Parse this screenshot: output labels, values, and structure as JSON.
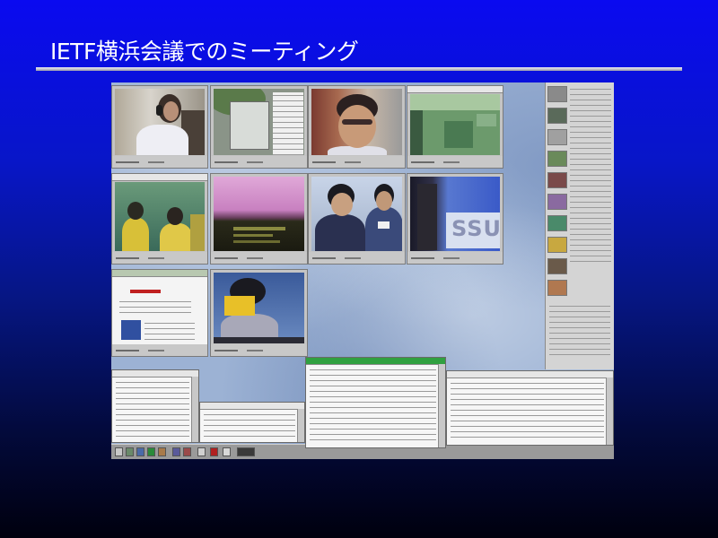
{
  "slide": {
    "title": "IETF横浜会議でのミーティング",
    "colors": {
      "background_top": "#0a0af0",
      "background_bottom": "#00000e",
      "title": "#ffffff",
      "rule": "#c8c8d0"
    }
  },
  "screenshot": {
    "banner_text": "SSU"
  }
}
